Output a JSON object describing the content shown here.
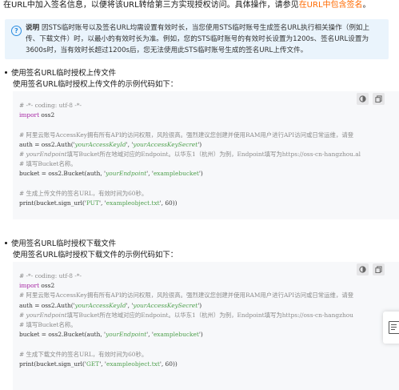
{
  "intro": {
    "text_before_link": "在URL中加入签名信息，以便将该URL转给第三方实现授权访问。具体操作，请参见",
    "link": "在URL中包含签名",
    "text_after_link": "。"
  },
  "note": {
    "icon": "info-icon",
    "label": "说明",
    "line1": "因STS临时账号以及签名URL均需设置有效时长，当您使用STS临时账号生成签名URL执行相关操作（例如上",
    "line2": "传、下载文件）时，以最小的有效时长为准。例如，您的STS临时账号的有效时长设置为1200s、签名URL设置为",
    "line3": "3600s时，当有效时长超过1200s后，您无法使用此STS临时账号生成的签名URL上传文件。"
  },
  "upload_section": {
    "bullet": "使用签名URL临时授权上传文件",
    "intro": "使用签名URL临时授权上传文件的示例代码如下：",
    "code": {
      "l1": "# -*- coding: utf-8 -*-",
      "l2_kw": "import",
      "l2_rest": " oss2",
      "l3": "# 阿里云账号AccessKey拥有所有API的访问权限，风险很高。强烈建议您创建并使用RAM用户进行API访问或日常运维，请登",
      "l4_a": "auth = oss2.Auth('",
      "l4_s1": "yourAccessKeyId",
      "l4_b": "', '",
      "l4_s2": "yourAccessKeySecret",
      "l4_c": "')",
      "l5_a": "# ",
      "l5_it": "yourEndpoint",
      "l5_b": "填写Bucket所在地域对应的Endpoint。以华东1（杭州）为例，Endpoint填写为https://oss-cn-hangzhou.al",
      "l6": "# 填写Bucket名称。",
      "l7_a": "bucket = oss2.Bucket(auth, '",
      "l7_s1": "yourEndpoint",
      "l7_b": "', '",
      "l7_s2": "examplebucket",
      "l7_c": "')",
      "l8": "# 生成上传文件的签名URL，有效时间为60秒。",
      "l9_a": "print(bucket.sign_url('",
      "l9_s1": "PUT",
      "l9_b": "', '",
      "l9_s2": "exampleobject.txt",
      "l9_c": "', 60))"
    }
  },
  "download_section": {
    "bullet": "使用签名URL临时授权下载文件",
    "intro": "使用签名URL临时授权下载文件的示例代码如下：",
    "code": {
      "l1": "# -*- coding: utf-8 -*-",
      "l2_kw": "import",
      "l2_rest": " oss2",
      "l3": "# 阿里云账号AccessKey拥有所有API的访问权限，风险很高。强烈建议您创建并使用RAM用户进行API访问或日常运维，请登",
      "l4_a": "auth = oss2.Auth('",
      "l4_s1": "yourAccessKeyId",
      "l4_b": "', '",
      "l4_s2": "yourAccessKeySecret",
      "l4_c": "')",
      "l5_a": "# ",
      "l5_it": "yourEndpoint",
      "l5_b": "填写Bucket所在地域对应的Endpoint。以华东1（杭州）为例，Endpoint填写为https://oss-cn-hangzhou",
      "l6": "# 填写Bucket名称。",
      "l7_a": "bucket = oss2.Bucket(auth, '",
      "l7_s1": "yourEndpoint",
      "l7_b": "', '",
      "l7_s2": "examplebucket",
      "l7_c": "')",
      "l8": "# 生成下载文件的签名URL，有效时间为60秒。",
      "l9_a": "print(bucket.sign_url('",
      "l9_s1": "GET",
      "l9_b": "', '",
      "l9_s2": "exampleobject.txt",
      "l9_c": "', 60))"
    }
  },
  "toolbar_icons": {
    "theme": "theme-toggle-icon",
    "copy": "copy-icon"
  },
  "floating_panel_icon": "document-feedback-icon",
  "colors": {
    "link": "#ff6a00",
    "note_bg": "#eaf4fc",
    "info_icon": "#2a8cdf",
    "code_bg": "#f7f8fa",
    "code_comment": "#8b8b8b",
    "code_keyword": "#a626a4",
    "code_string": "#50a14f"
  }
}
